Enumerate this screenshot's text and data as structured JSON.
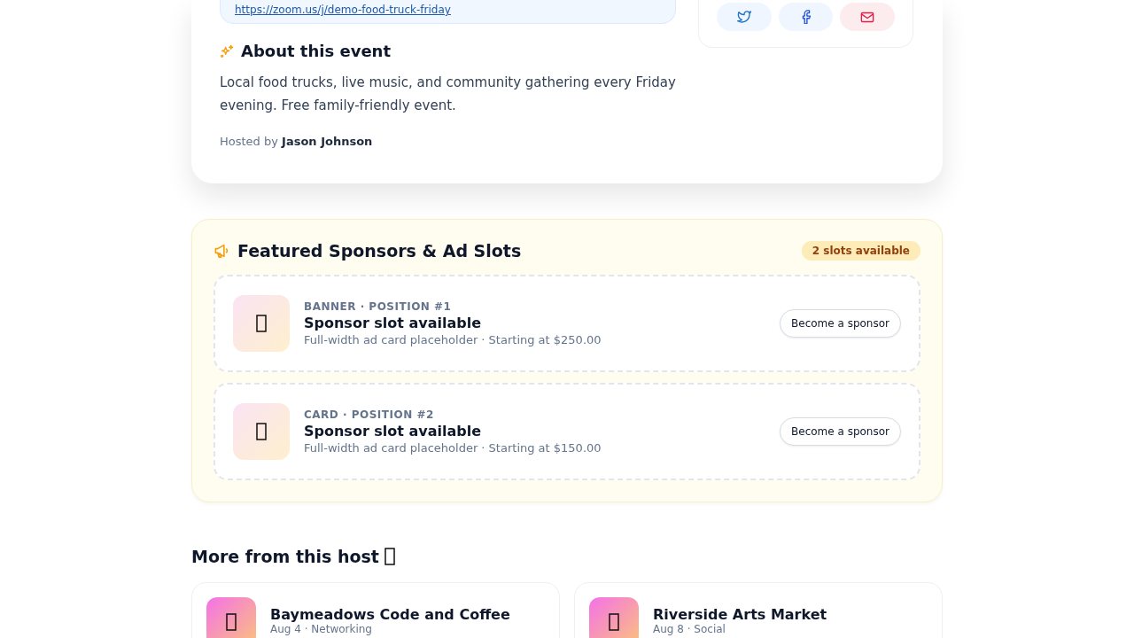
{
  "event": {
    "link": "https://zoom.us/j/demo-food-truck-friday",
    "about_title": "About this event",
    "description": "Local food trucks, live music, and community gathering every Friday evening. Free family-friendly event.",
    "hosted_label": "Hosted by",
    "host": "Jason Johnson",
    "share": [
      {
        "kind": "twitter"
      },
      {
        "kind": "facebook"
      },
      {
        "kind": "email"
      }
    ]
  },
  "sponsors": {
    "title": "Featured Sponsors & Ad Slots",
    "badge": "2 slots available",
    "slots": [
      {
        "label": "BANNER · POSITION #1",
        "title": "Sponsor slot available",
        "detail": "Full-width ad card placeholder · Starting at $250.00",
        "button": "Become a sponsor"
      },
      {
        "label": "CARD · POSITION #2",
        "title": "Sponsor slot available",
        "detail": "Full-width ad card placeholder · Starting at $150.00",
        "button": "Become a sponsor"
      }
    ]
  },
  "more": {
    "title": "More from this host",
    "events": [
      {
        "title": "Baymeadows Code and Coffee",
        "meta": "Aug 4 · Networking"
      },
      {
        "title": "Riverside Arts Market",
        "meta": "Aug 8 · Social"
      }
    ]
  }
}
